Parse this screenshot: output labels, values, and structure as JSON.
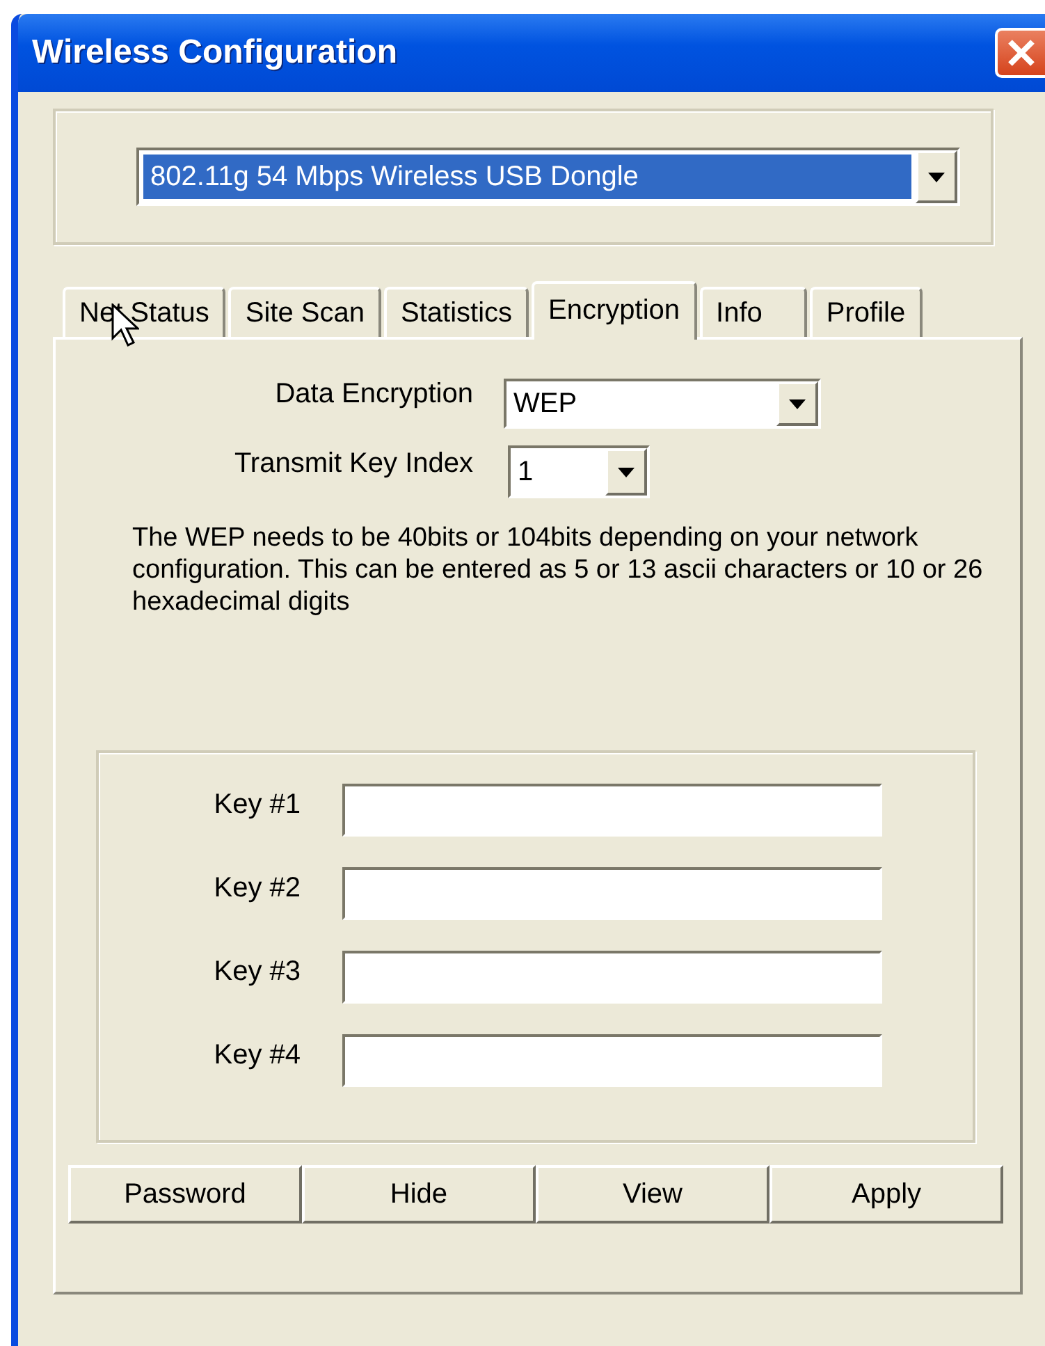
{
  "window": {
    "title": "Wireless Configuration"
  },
  "adapter": {
    "value": "802.11g 54 Mbps Wireless USB Dongle",
    "selected": true
  },
  "tabs": [
    {
      "label": "Net Status",
      "selected": false
    },
    {
      "label": "Site Scan",
      "selected": false
    },
    {
      "label": "Statistics",
      "selected": false
    },
    {
      "label": "Encryption",
      "selected": true
    },
    {
      "label": "Info",
      "selected": false
    },
    {
      "label": "Profile",
      "selected": false
    }
  ],
  "encryption": {
    "data_encryption": {
      "label": "Data Encryption",
      "value": "WEP"
    },
    "transmit_key_index": {
      "label": "Transmit Key Index",
      "value": "1"
    },
    "note": "The WEP needs to be 40bits or 104bits depending on your network configuration. This can be entered as 5 or 13 ascii characters or 10 or 26 hexadecimal digits",
    "keys": [
      {
        "label": "Key #1"
      },
      {
        "label": "Key #2"
      },
      {
        "label": "Key #3"
      },
      {
        "label": "Key #4"
      }
    ]
  },
  "buttons": [
    "Password",
    "Hide",
    "View",
    "Apply"
  ]
}
